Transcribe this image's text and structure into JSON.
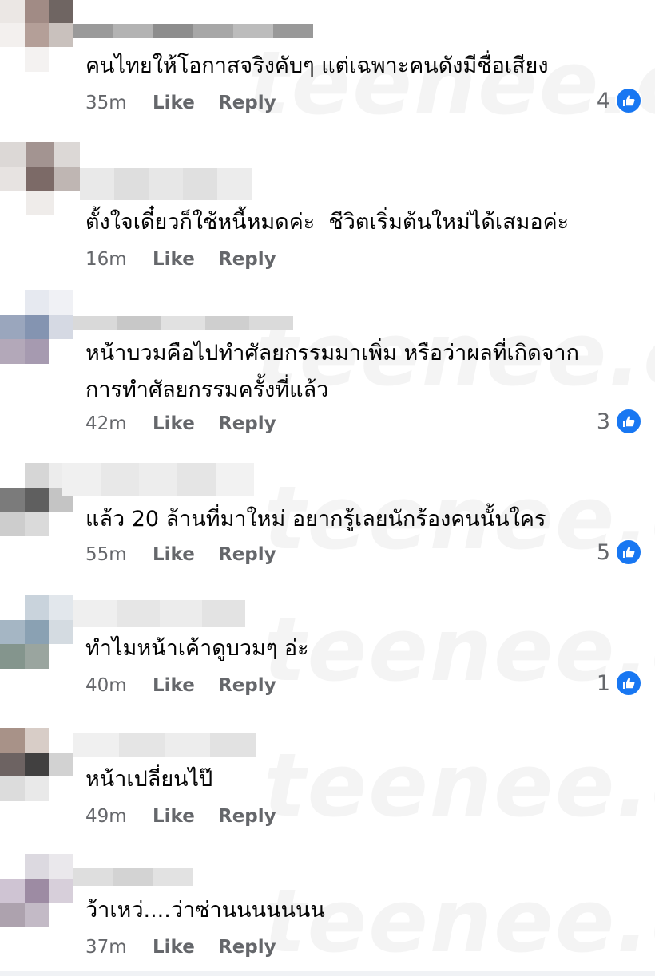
{
  "watermark": "teenee.com",
  "comments": [
    {
      "text": "คนไทยให้โอกาสจริงคับๆ แต่เฉพาะคนดังมีชื่อเสียง",
      "time": "35m",
      "like_label": "Like",
      "reply_label": "Reply",
      "reactions": "4"
    },
    {
      "text": "ตั้งใจเดี๋ยวก็ใช้หนี้หมดค่ะ  ชีวิตเริ่มต้นใหม่ได้เสมอค่ะ",
      "time": "16m",
      "like_label": "Like",
      "reply_label": "Reply",
      "reactions": ""
    },
    {
      "text": "หน้าบวมคือไปทำศัลยกรรมมาเพิ่ม หรือว่าผลที่เกิดจาก\nการทำศัลยกรรมครั้งที่แล้ว",
      "time": "42m",
      "like_label": "Like",
      "reply_label": "Reply",
      "reactions": "3"
    },
    {
      "text": "แล้ว 20 ล้านที่มาใหม่ อยากรู้เลยนักร้องคนนั้นใคร",
      "time": "55m",
      "like_label": "Like",
      "reply_label": "Reply",
      "reactions": "5"
    },
    {
      "text": "ทำไมหน้าเค้าดูบวมๆ อ่ะ",
      "time": "40m",
      "like_label": "Like",
      "reply_label": "Reply",
      "reactions": "1"
    },
    {
      "text": "หน้าเปลี่ยนไป๊",
      "time": "49m",
      "like_label": "Like",
      "reply_label": "Reply",
      "reactions": ""
    },
    {
      "text": "ว้าเหว่....ว่าซ่านนนนนนน",
      "time": "37m",
      "like_label": "Like",
      "reply_label": "Reply",
      "reactions": ""
    }
  ],
  "colors": {
    "accent": "#1877f2",
    "meta_text": "#65676b",
    "body_text": "#050505"
  },
  "icons": {
    "reaction": "thumbs-up-icon"
  }
}
